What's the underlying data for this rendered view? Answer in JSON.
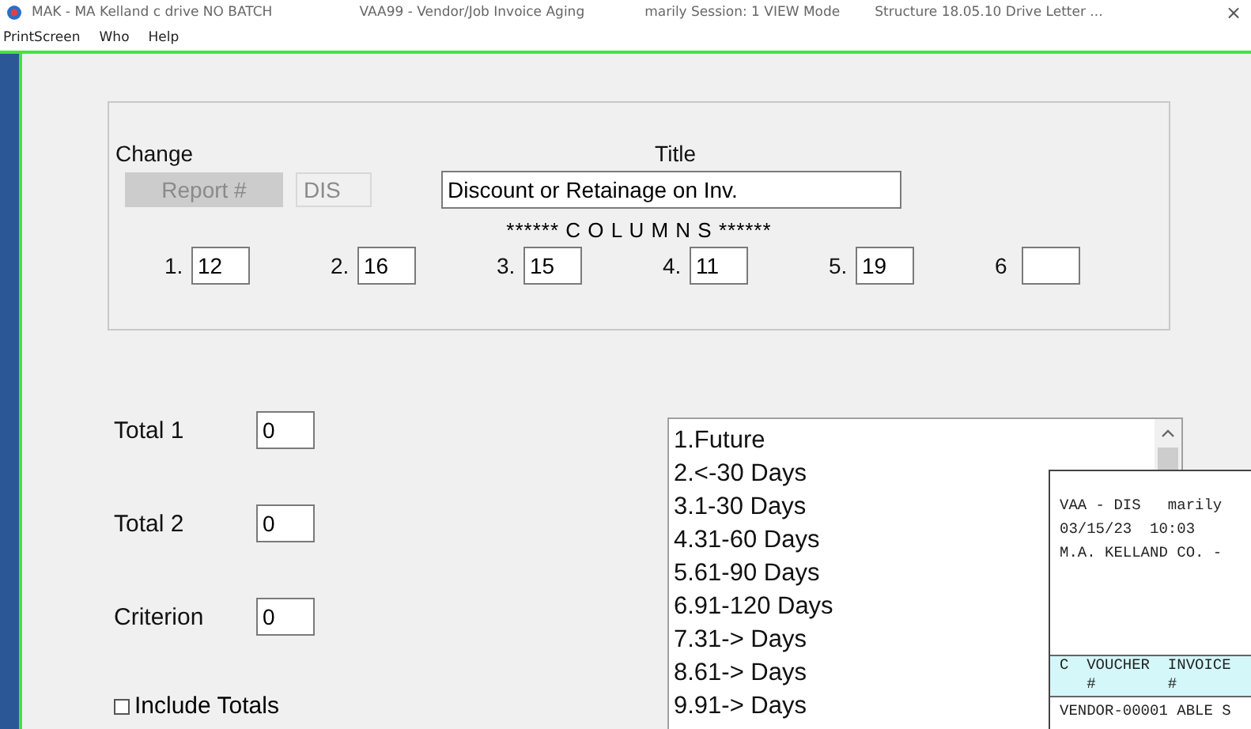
{
  "window": {
    "title_parts": [
      "MAK - MA Kelland c drive NO BATCH",
      "VAA99 - Vendor/Job Invoice Aging",
      "marily  Session:  1  VIEW  Mode",
      "Structure 18.05.10  Drive Letter ..."
    ],
    "close": "×"
  },
  "menu": [
    "PrintScreen",
    "Who",
    "Help"
  ],
  "report": {
    "change_label": "Change",
    "report_button": {
      "label": "Report #",
      "disabled": true
    },
    "report_code": "DIS",
    "title_label": "Title",
    "title_value": "Discount or Retainage on Inv.",
    "columns_heading": "****** C O L U M N S ******",
    "columns": [
      {
        "label": "1.",
        "value": "12"
      },
      {
        "label": "2.",
        "value": "16"
      },
      {
        "label": "3.",
        "value": "15"
      },
      {
        "label": "4.",
        "value": "11"
      },
      {
        "label": "5.",
        "value": "19"
      },
      {
        "label": "6"
      }
    ]
  },
  "totals": [
    {
      "label": "Total 1",
      "value": "0"
    },
    {
      "label": "Total 2",
      "value": "0"
    },
    {
      "label": "Criterion",
      "value": "0"
    }
  ],
  "include_totals": {
    "label": "Include Totals",
    "checked": false
  },
  "column_list": {
    "items": [
      "1.Future",
      "2.<-30 Days",
      "3.1-30 Days",
      "4.31-60 Days",
      "5.61-90 Days",
      "6.91-120 Days",
      "7.31-> Days",
      "8.61-> Days",
      "9.91-> Days"
    ]
  },
  "preview": {
    "lines": [
      "VAA - DIS   marily",
      "03/15/23  10:03",
      "M.A. KELLAND CO. -"
    ],
    "header": [
      "C  VOUCHER  INVOICE",
      "   #        #"
    ],
    "rows": [
      "VENDOR-00001 ABLE S"
    ]
  }
}
